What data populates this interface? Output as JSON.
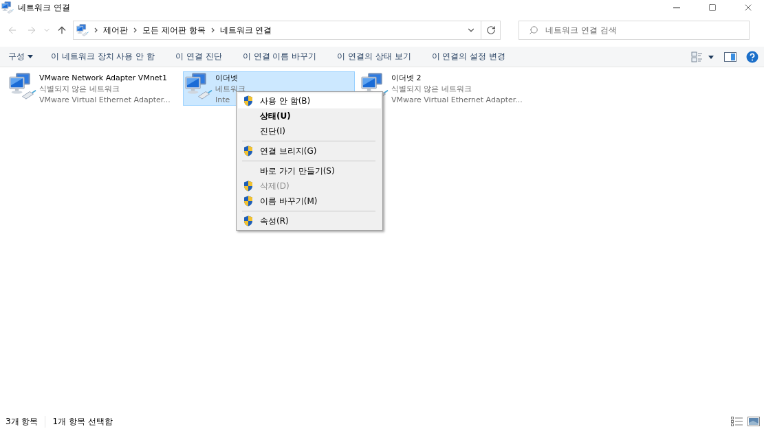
{
  "window": {
    "title": "네트워크 연결"
  },
  "address_bar": {
    "breadcrumbs": [
      "제어판",
      "모든 제어판 항목",
      "네트워크 연결"
    ]
  },
  "search": {
    "placeholder": "네트워크 연결 검색"
  },
  "toolbar": {
    "items": [
      {
        "label": "구성",
        "dropdown": true
      },
      {
        "label": "이 네트워크 장치 사용 안 함",
        "dropdown": false
      },
      {
        "label": "이 연결 진단",
        "dropdown": false
      },
      {
        "label": "이 연결 이름 바꾸기",
        "dropdown": false
      },
      {
        "label": "이 연결의 상태 보기",
        "dropdown": false
      },
      {
        "label": "이 연결의 설정 변경",
        "dropdown": false
      }
    ]
  },
  "connections": [
    {
      "name": "VMware Network Adapter VMnet1",
      "status": "식별되지 않은 네트워크",
      "device": "VMware Virtual Ethernet Adapter...",
      "selected": false
    },
    {
      "name": "이더넷",
      "status": "네트워크",
      "device": "Inte",
      "selected": true
    },
    {
      "name": "이더넷 2",
      "status": "식별되지 않은 네트워크",
      "device": "VMware Virtual Ethernet Adapter...",
      "selected": false
    }
  ],
  "context_menu": {
    "items": [
      {
        "kind": "item",
        "label": "사용 안 함(B)",
        "shield": true,
        "default": false,
        "disabled": false,
        "highlighted": true
      },
      {
        "kind": "item",
        "label": "상태(U)",
        "shield": false,
        "default": true,
        "disabled": false,
        "highlighted": false
      },
      {
        "kind": "item",
        "label": "진단(I)",
        "shield": false,
        "default": false,
        "disabled": false,
        "highlighted": false
      },
      {
        "kind": "separator"
      },
      {
        "kind": "item",
        "label": "연결 브리지(G)",
        "shield": true,
        "default": false,
        "disabled": false,
        "highlighted": false
      },
      {
        "kind": "separator"
      },
      {
        "kind": "item",
        "label": "바로 가기 만들기(S)",
        "shield": false,
        "default": false,
        "disabled": false,
        "highlighted": false
      },
      {
        "kind": "item",
        "label": "삭제(D)",
        "shield": true,
        "default": false,
        "disabled": true,
        "highlighted": false
      },
      {
        "kind": "item",
        "label": "이름 바꾸기(M)",
        "shield": true,
        "default": false,
        "disabled": false,
        "highlighted": false
      },
      {
        "kind": "separator"
      },
      {
        "kind": "item",
        "label": "속성(R)",
        "shield": true,
        "default": false,
        "disabled": false,
        "highlighted": false
      }
    ]
  },
  "status_bar": {
    "item_count": "3개 항목",
    "selected_count": "1개 항목 선택함"
  }
}
